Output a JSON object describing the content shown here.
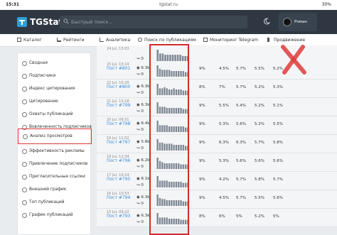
{
  "status": {
    "time": "15:31",
    "url": "tgstat.ru",
    "battery": "30%"
  },
  "header": {
    "logo": "TGStat",
    "search_placeholder": "Быстрый поиск...",
    "user_name": "Роман"
  },
  "nav": [
    {
      "label": "Каталог",
      "icon": "grid-icon"
    },
    {
      "label": "Рейтинги",
      "icon": "chart-icon"
    },
    {
      "label": "Аналитика",
      "icon": "analytics-icon"
    },
    {
      "label": "Поиск по публикациям",
      "icon": "search-icon"
    },
    {
      "label": "Мониторинг Telegram",
      "icon": "monitor-icon"
    },
    {
      "label": "Продвижение",
      "icon": "promo-icon"
    }
  ],
  "sidebar": [
    {
      "label": "Сводная"
    },
    {
      "label": "Подписчики"
    },
    {
      "label": "Индекс цитирования"
    },
    {
      "label": "Цитирование"
    },
    {
      "label": "Охваты публикаций"
    },
    {
      "label": "Вовлеченность подписчиков"
    },
    {
      "label": "Анализ просмотров",
      "active": true
    },
    {
      "label": "Эффективность рекламы"
    },
    {
      "label": "Привлечение подписчиков"
    },
    {
      "label": "Пригласительные ссылки"
    },
    {
      "label": "Внешний график"
    },
    {
      "label": "Топ публикаций"
    },
    {
      "label": "График публикаций"
    }
  ],
  "rows": [
    {
      "date": "24 Jul, 13:03",
      "post": "",
      "views": "",
      "shares": "0",
      "cols": [
        "",
        "",
        "",
        "",
        "",
        "",
        ""
      ],
      "spark": [
        9,
        6,
        6,
        5,
        5,
        5,
        5,
        5,
        5,
        5,
        4,
        4,
        4
      ]
    },
    {
      "date": "23 Jul, 15:14",
      "post": "Пост #801",
      "views": "6.3k",
      "shares": "0",
      "cols": [
        "9%",
        "4.5%",
        "5.7%",
        "5.5%",
        "5.2%",
        "",
        ""
      ],
      "spark": [
        10,
        7,
        6,
        6,
        6,
        6,
        5,
        5,
        5,
        5,
        5,
        5,
        4,
        4
      ]
    },
    {
      "date": "22 Jul, 10:20",
      "post": "Пост #800",
      "views": "6.3k",
      "shares": "0",
      "cols": [
        "8%",
        "7%",
        "5.7%",
        "5.2%",
        "5.3%",
        "",
        ""
      ],
      "spark": [
        10,
        6,
        6,
        7,
        6,
        5,
        5,
        6,
        5,
        5,
        5,
        4,
        4,
        4
      ]
    },
    {
      "date": "21 Jul, 13:18",
      "post": "Пост #799",
      "views": "6.3k",
      "shares": "0",
      "cols": [
        "9%",
        "5.5%",
        "5.4%",
        "5.2%",
        "5.1%",
        "",
        ""
      ],
      "spark": [
        10,
        6,
        6,
        6,
        5,
        5,
        5,
        5,
        5,
        5,
        5,
        4,
        4,
        4
      ]
    },
    {
      "date": "20 Jul, 09:31",
      "post": "Пост #798",
      "views": "6.4k",
      "shares": "0",
      "cols": [
        "9%",
        "5.3%",
        "5.6%",
        "5.2%",
        "5.5%",
        "",
        ""
      ],
      "spark": [
        10,
        6,
        6,
        6,
        6,
        5,
        5,
        5,
        5,
        5,
        5,
        5,
        4,
        4
      ]
    },
    {
      "date": "19 Jul, 11:52",
      "post": "Пост #797",
      "views": "5.8k",
      "shares": "0",
      "cols": [
        "9%",
        "6.3%",
        "6.3%",
        "5.7%",
        "5.8%",
        "",
        ""
      ],
      "spark": [
        10,
        7,
        7,
        6,
        6,
        6,
        6,
        5,
        5,
        5,
        5,
        5,
        4,
        4
      ]
    },
    {
      "date": "18 Jul, 12:34",
      "post": "Пост #796",
      "views": "6.2k",
      "shares": "0",
      "cols": [
        "9%",
        "5.3%",
        "5.6%",
        "5.6%",
        "5.6%",
        "",
        ""
      ],
      "spark": [
        10,
        7,
        6,
        5,
        5,
        5,
        5,
        5,
        5,
        5,
        4,
        4,
        4,
        4
      ]
    },
    {
      "date": "17 Jul, 10:14",
      "post": "Пост #795",
      "views": "6.1k",
      "shares": "0",
      "cols": [
        "9%",
        "4.2%",
        "5.7%",
        "5.8%",
        "5.7%",
        "",
        ""
      ],
      "spark": [
        10,
        6,
        6,
        6,
        6,
        5,
        5,
        5,
        5,
        5,
        5,
        4,
        4,
        4
      ]
    },
    {
      "date": "16 Jul, 10:53",
      "post": "Пост #794",
      "views": "6.3k",
      "shares": "0",
      "cols": [
        "9%",
        "4.5%",
        "5.7%",
        "5.5%",
        "5.6%",
        "",
        ""
      ],
      "spark": [
        10,
        7,
        6,
        6,
        5,
        5,
        5,
        5,
        5,
        5,
        5,
        4,
        4,
        4
      ]
    },
    {
      "date": "15 Jul, 09:22",
      "post": "Пост #793",
      "views": "6.3k",
      "shares": "0",
      "cols": [
        "8%",
        "6%",
        "5%",
        "5.2%",
        "5%",
        "",
        ""
      ],
      "spark": [
        10,
        6,
        6,
        6,
        6,
        5,
        5,
        5,
        5,
        5,
        4,
        4,
        4,
        4
      ]
    }
  ],
  "colors": {
    "header_bg": "#2f3842",
    "link": "#3a8dd6",
    "highlight": "#d42a2c"
  }
}
